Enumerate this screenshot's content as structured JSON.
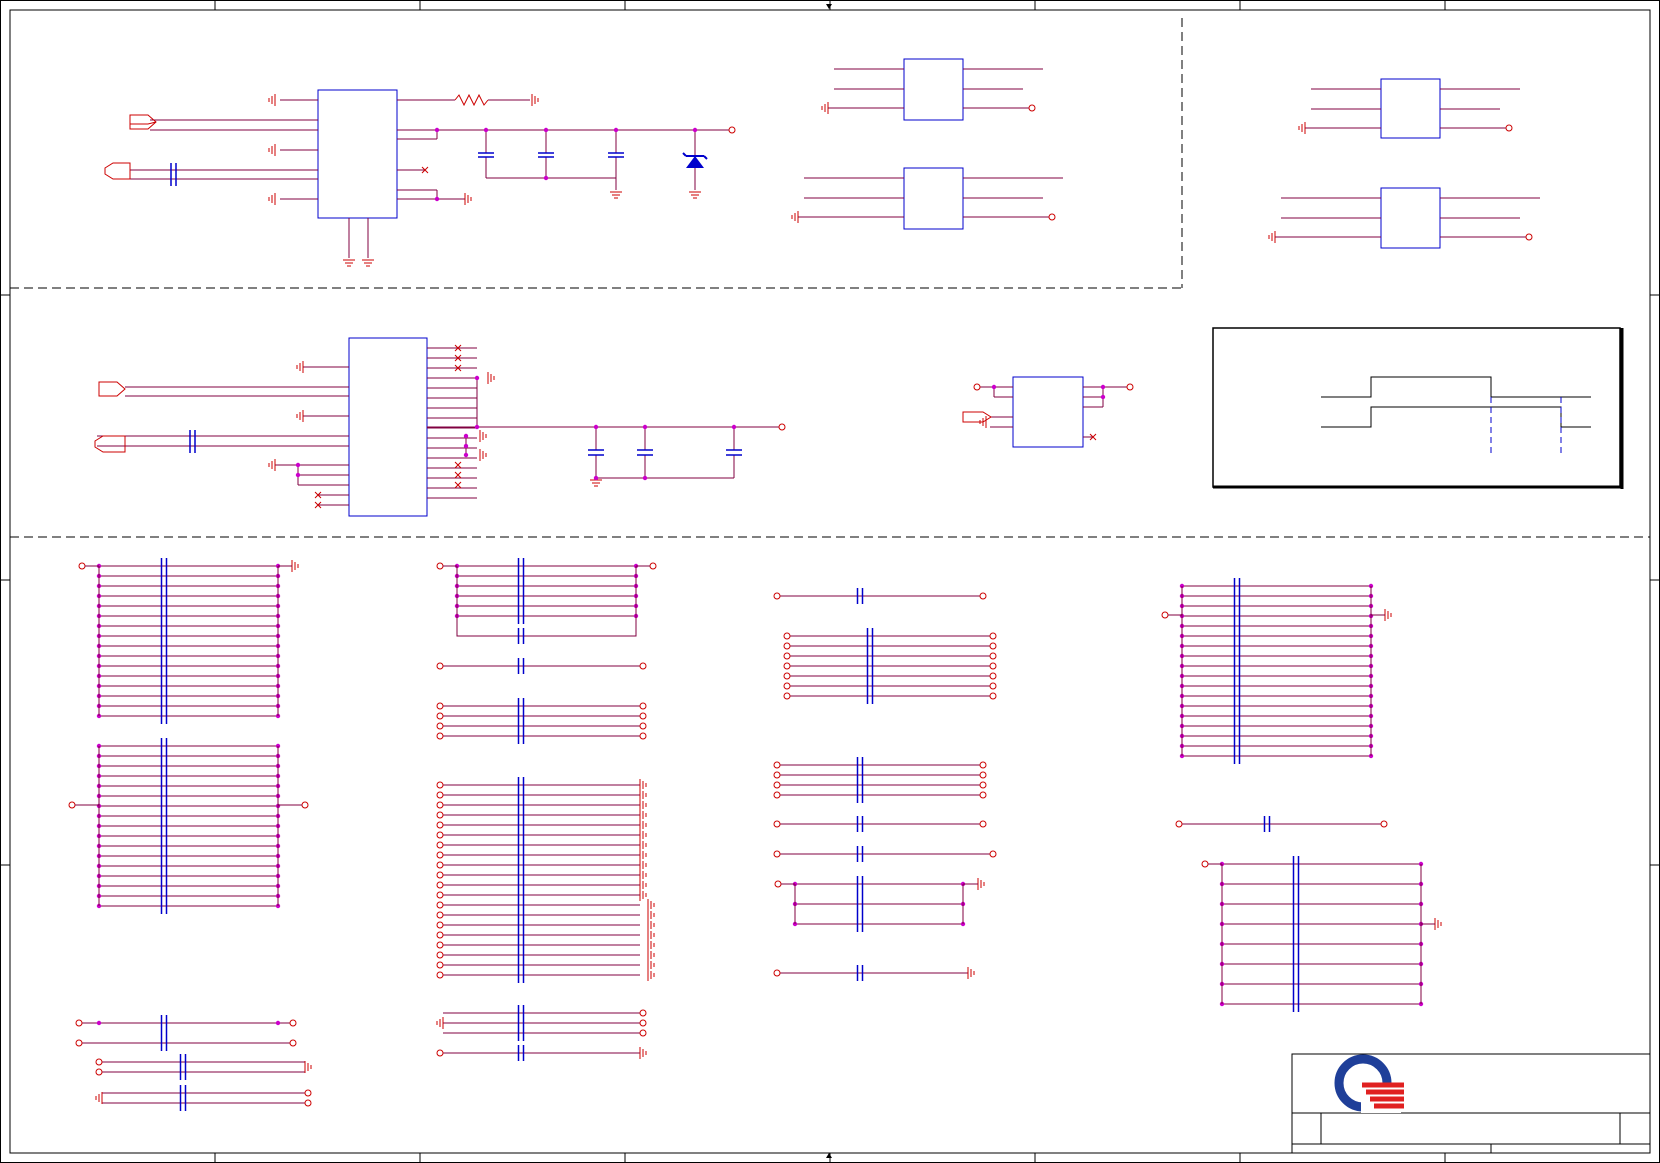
{
  "colors": {
    "wire": "#cc0000",
    "net": "#800040",
    "part": "#0000cc",
    "junction": "#cc00cc",
    "frame": "#000000",
    "logo_blue": "#1f3f99",
    "logo_red": "#e02020"
  },
  "icons": {
    "logo": "quanta-logo-icon",
    "ground": "ground-icon",
    "capacitor": "capacitor-icon",
    "zener": "zener-diode-icon",
    "resistor": "resistor-icon",
    "connector": "offpage-connector-icon"
  },
  "frame": {
    "zone_divisions": 8
  }
}
